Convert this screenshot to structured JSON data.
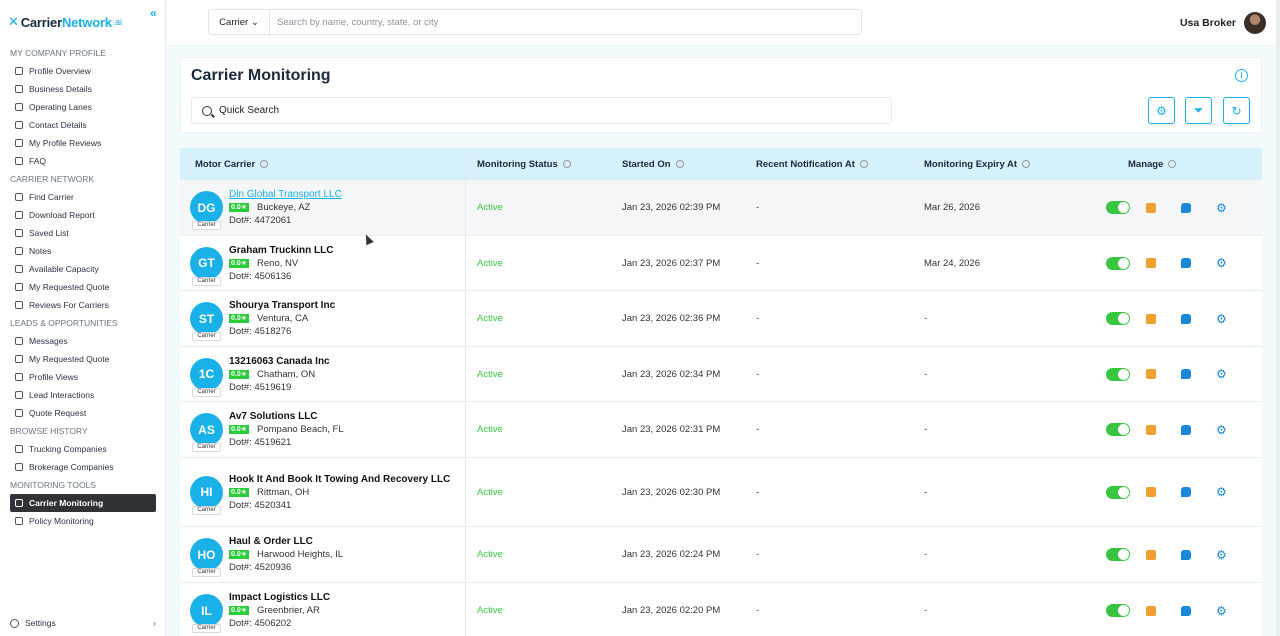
{
  "app": {
    "logo_prefix": "Carrier",
    "logo_suffix": "Network",
    "logo_ai": ".ai"
  },
  "sidebar": {
    "sections": [
      {
        "title": "MY COMPANY PROFILE",
        "items": [
          "Profile Overview",
          "Business Details",
          "Operating Lanes",
          "Contact Details",
          "My Profile Reviews",
          "FAQ"
        ]
      },
      {
        "title": "CARRIER NETWORK",
        "items": [
          "Find Carrier",
          "Download Report",
          "Saved List",
          "Notes",
          "Available Capacity",
          "My Requested Quote",
          "Reviews For Carriers"
        ]
      },
      {
        "title": "LEADS & OPPORTUNITIES",
        "items": [
          "Messages",
          "My Requested Quote",
          "Profile Views",
          "Lead Interactions",
          "Quote Request"
        ]
      },
      {
        "title": "BROWSE HISTORY",
        "items": [
          "Trucking Companies",
          "Brokerage Companies"
        ]
      },
      {
        "title": "MONITORING TOOLS",
        "items": [
          "Carrier Monitoring",
          "Policy Monitoring"
        ]
      }
    ],
    "active_item": "Carrier Monitoring",
    "settings_label": "Settings"
  },
  "topbar": {
    "search_type": "Carrier",
    "search_placeholder": "Search by name, country, state, or city",
    "user_name": "Usa Broker"
  },
  "page": {
    "title": "Carrier Monitoring",
    "quick_search": "Quick Search"
  },
  "table": {
    "headers": [
      "Motor Carrier",
      "Monitoring Status",
      "Started On",
      "Recent Notification At",
      "Monitoring Expiry At",
      "Manage"
    ],
    "badge_tag": "Carrier",
    "rows": [
      {
        "initials": "DG",
        "name": "Dln Global Transport LLC",
        "rating": "0.0★",
        "location": "Buckeye, AZ",
        "dot": "Dot#: 4472061",
        "status": "Active",
        "started": "Jan 23, 2026 02:39 PM",
        "recent": "-",
        "expiry": "Mar 26, 2026"
      },
      {
        "initials": "GT",
        "name": "Graham Truckinn LLC",
        "rating": "0.0★",
        "location": "Reno, NV",
        "dot": "Dot#: 4506136",
        "status": "Active",
        "started": "Jan 23, 2026 02:37 PM",
        "recent": "-",
        "expiry": "Mar 24, 2026"
      },
      {
        "initials": "ST",
        "name": "Shourya Transport Inc",
        "rating": "0.0★",
        "location": "Ventura, CA",
        "dot": "Dot#: 4518276",
        "status": "Active",
        "started": "Jan 23, 2026 02:36 PM",
        "recent": "-",
        "expiry": "-"
      },
      {
        "initials": "1C",
        "name": "13216063 Canada Inc",
        "rating": "0.0★",
        "location": "Chatham, ON",
        "dot": "Dot#: 4519619",
        "status": "Active",
        "started": "Jan 23, 2026 02:34 PM",
        "recent": "-",
        "expiry": "-"
      },
      {
        "initials": "AS",
        "name": "Av7 Solutions LLC",
        "rating": "0.0★",
        "location": "Pompano Beach, FL",
        "dot": "Dot#: 4519621",
        "status": "Active",
        "started": "Jan 23, 2026 02:31 PM",
        "recent": "-",
        "expiry": "-"
      },
      {
        "initials": "HI",
        "name": "Hook It And Book It Towing And Recovery LLC",
        "rating": "0.0★",
        "location": "Rittman, OH",
        "dot": "Dot#: 4520341",
        "status": "Active",
        "started": "Jan 23, 2026 02:30 PM",
        "recent": "-",
        "expiry": "-"
      },
      {
        "initials": "HO",
        "name": "Haul & Order LLC",
        "rating": "0.0★",
        "location": "Harwood Heights, IL",
        "dot": "Dot#: 4520936",
        "status": "Active",
        "started": "Jan 23, 2026 02:24 PM",
        "recent": "-",
        "expiry": "-"
      },
      {
        "initials": "IL",
        "name": "Impact Logistics LLC",
        "rating": "0.0★",
        "location": "Greenbrier, AR",
        "dot": "Dot#: 4506202",
        "status": "Active",
        "started": "Jan 23, 2026 02:20 PM",
        "recent": "-",
        "expiry": "-"
      }
    ]
  },
  "colors": {
    "accent": "#1ab0e8",
    "active_status": "#38c640",
    "header_bg": "#d5f1fc",
    "sidebar_active": "#2f3338"
  }
}
